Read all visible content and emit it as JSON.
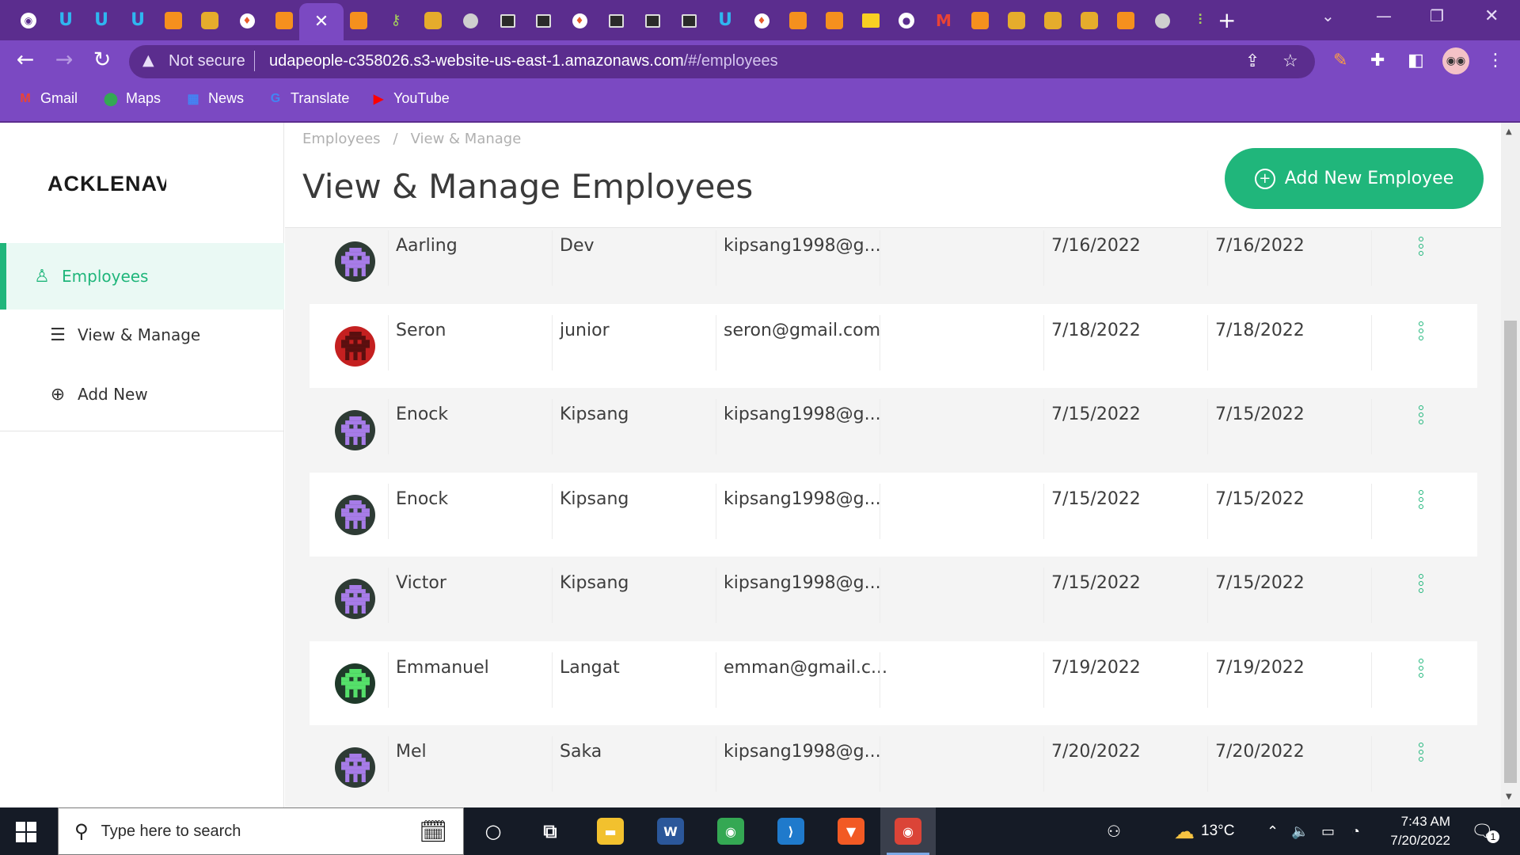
{
  "browser": {
    "tabs": [
      {
        "icon": "circle-target-icon",
        "style": "gh",
        "glyph": "◉"
      },
      {
        "icon": "udacity-icon",
        "style": "u",
        "glyph": "U"
      },
      {
        "icon": "udacity-icon",
        "style": "u",
        "glyph": "U"
      },
      {
        "icon": "udacity-icon",
        "style": "u",
        "glyph": "U"
      },
      {
        "icon": "aws-cube-icon",
        "style": "cube",
        "glyph": ""
      },
      {
        "icon": "package-icon",
        "style": "box",
        "glyph": ""
      },
      {
        "icon": "fire-icon",
        "style": "fire",
        "glyph": "♦"
      },
      {
        "icon": "aws-cube-icon",
        "style": "cube",
        "glyph": ""
      },
      {
        "icon": "close-tab-icon",
        "style": "close",
        "glyph": "✕",
        "active": true
      },
      {
        "icon": "aws-cube-icon",
        "style": "cube",
        "glyph": ""
      },
      {
        "icon": "key-icon",
        "style": "key",
        "glyph": "⚷"
      },
      {
        "icon": "package-icon",
        "style": "box",
        "glyph": ""
      },
      {
        "icon": "globe-icon",
        "style": "globe",
        "glyph": ""
      },
      {
        "icon": "terminal-icon",
        "style": "term",
        "glyph": ""
      },
      {
        "icon": "terminal-icon",
        "style": "term",
        "glyph": ""
      },
      {
        "icon": "fire-icon",
        "style": "fire",
        "glyph": "♦"
      },
      {
        "icon": "terminal-icon",
        "style": "term",
        "glyph": ""
      },
      {
        "icon": "terminal-icon",
        "style": "term",
        "glyph": ""
      },
      {
        "icon": "terminal-icon",
        "style": "term",
        "glyph": ""
      },
      {
        "icon": "udacity-icon",
        "style": "u",
        "glyph": "U"
      },
      {
        "icon": "fire-icon",
        "style": "fire",
        "glyph": "♦"
      },
      {
        "icon": "aws-cube-icon",
        "style": "cube",
        "glyph": ""
      },
      {
        "icon": "aws-cube-icon",
        "style": "cube",
        "glyph": ""
      },
      {
        "icon": "slides-icon",
        "style": "yellow",
        "glyph": ""
      },
      {
        "icon": "github-icon",
        "style": "gh",
        "glyph": "●"
      },
      {
        "icon": "gmail-icon",
        "style": "m",
        "glyph": "M"
      },
      {
        "icon": "aws-cube-icon",
        "style": "cube",
        "glyph": ""
      },
      {
        "icon": "package-icon",
        "style": "box",
        "glyph": ""
      },
      {
        "icon": "package-icon",
        "style": "box",
        "glyph": ""
      },
      {
        "icon": "package-icon",
        "style": "box",
        "glyph": ""
      },
      {
        "icon": "aws-cube-icon",
        "style": "cube",
        "glyph": ""
      },
      {
        "icon": "globe-icon",
        "style": "globe",
        "glyph": ""
      },
      {
        "icon": "candles-icon",
        "style": "key",
        "glyph": "⫶"
      }
    ],
    "security_label": "Not secure",
    "url_host": "udapeople-c358026.s3-website-us-east-1.amazonaws.com",
    "url_path": "/#/employees",
    "bookmarks": [
      {
        "label": "Gmail",
        "icon": "gmail-icon",
        "glyph": "M",
        "color": "#ea4335"
      },
      {
        "label": "Maps",
        "icon": "maps-icon",
        "glyph": "⬤",
        "color": "#34a853"
      },
      {
        "label": "News",
        "icon": "news-icon",
        "glyph": "▦",
        "color": "#4285f4"
      },
      {
        "label": "Translate",
        "icon": "translate-icon",
        "glyph": "G",
        "color": "#4285f4"
      },
      {
        "label": "YouTube",
        "icon": "youtube-icon",
        "glyph": "▶",
        "color": "#ff0000"
      }
    ]
  },
  "app": {
    "logo": "ACKLENAVENUE",
    "sidebar": [
      {
        "label": "Employees",
        "icon": "user-icon",
        "glyph": "♙",
        "active": true
      },
      {
        "label": "View & Manage",
        "icon": "list-icon",
        "glyph": "☰",
        "active": false
      },
      {
        "label": "Add New",
        "icon": "plus-circle-icon",
        "glyph": "⊕",
        "active": false
      }
    ],
    "breadcrumb": [
      "Employees",
      "View & Manage"
    ],
    "title": "View & Manage Employees",
    "add_button": "Add New Employee",
    "colors": {
      "accent": "#20b67b",
      "browser": "#7b49c2",
      "tabstrip": "#5b2d8e"
    },
    "employees": [
      {
        "first": "Aarling",
        "last": "Dev",
        "email": "kipsang1998@g...",
        "date1": "7/16/2022",
        "date2": "7/16/2022",
        "avatar_bg": "#2e3b35",
        "avatar_fg": "#a77ce8"
      },
      {
        "first": "Seron",
        "last": "junior",
        "email": "seron@gmail.com",
        "date1": "7/18/2022",
        "date2": "7/18/2022",
        "avatar_bg": "#c42020",
        "avatar_fg": "#5a0f0f"
      },
      {
        "first": "Enock",
        "last": "Kipsang",
        "email": "kipsang1998@g...",
        "date1": "7/15/2022",
        "date2": "7/15/2022",
        "avatar_bg": "#2e3b35",
        "avatar_fg": "#a77ce8"
      },
      {
        "first": "Enock",
        "last": "Kipsang",
        "email": "kipsang1998@g...",
        "date1": "7/15/2022",
        "date2": "7/15/2022",
        "avatar_bg": "#2e3b35",
        "avatar_fg": "#a77ce8"
      },
      {
        "first": "Victor",
        "last": "Kipsang",
        "email": "kipsang1998@g...",
        "date1": "7/15/2022",
        "date2": "7/15/2022",
        "avatar_bg": "#2e3b35",
        "avatar_fg": "#a77ce8"
      },
      {
        "first": "Emmanuel",
        "last": "Langat",
        "email": "emman@gmail.c...",
        "date1": "7/19/2022",
        "date2": "7/19/2022",
        "avatar_bg": "#1f3a2a",
        "avatar_fg": "#55e06a"
      },
      {
        "first": "Mel",
        "last": "Saka",
        "email": "kipsang1998@g...",
        "date1": "7/20/2022",
        "date2": "7/20/2022",
        "avatar_bg": "#2e3b35",
        "avatar_fg": "#a77ce8"
      }
    ]
  },
  "taskbar": {
    "search_placeholder": "Type here to search",
    "apps": [
      {
        "name": "cortana-icon",
        "glyph": "○",
        "bg": "transparent",
        "run": false
      },
      {
        "name": "task-view-icon",
        "glyph": "⧉",
        "bg": "transparent",
        "run": false
      },
      {
        "name": "file-explorer-icon",
        "glyph": "▬",
        "bg": "#f2c12e",
        "run": false
      },
      {
        "name": "word-icon",
        "glyph": "W",
        "bg": "#2b579a",
        "run": false
      },
      {
        "name": "chrome-icon",
        "glyph": "◉",
        "bg": "#34a853",
        "run": false
      },
      {
        "name": "vscode-icon",
        "glyph": "⟩",
        "bg": "#1f7acc",
        "run": false
      },
      {
        "name": "brave-icon",
        "glyph": "▼",
        "bg": "#f25a24",
        "run": false
      },
      {
        "name": "chrome-profile-icon",
        "glyph": "◉",
        "bg": "#db4437",
        "run": true,
        "active": true
      }
    ],
    "weather_temp": "13°C",
    "time": "7:43 AM",
    "date": "7/20/2022",
    "notification_count": "1"
  }
}
